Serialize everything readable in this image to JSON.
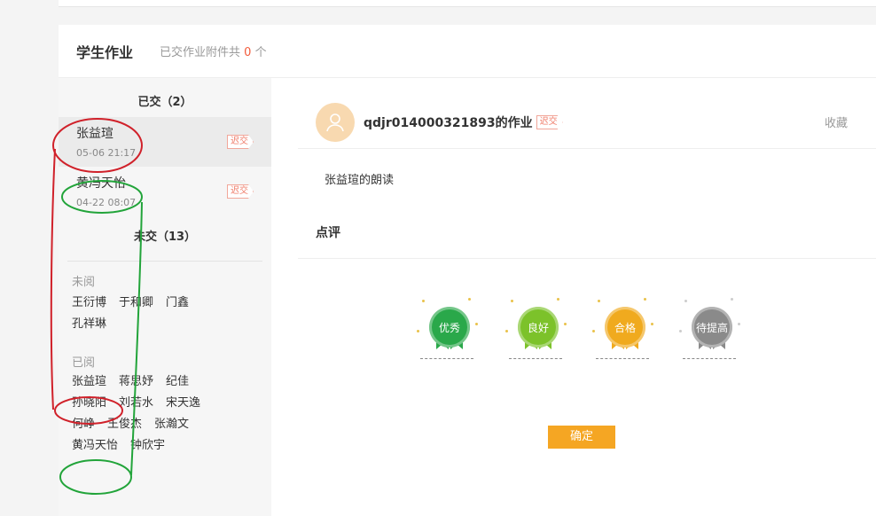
{
  "card": {
    "title": "学生作业",
    "sub_prefix": "已交作业附件共",
    "sub_count": "0",
    "sub_unit": "个"
  },
  "sidebar": {
    "submitted_title": "已交（2）",
    "submissions": [
      {
        "name": "张益瑄",
        "time": "05-06 21:17",
        "tag": "迟交"
      },
      {
        "name": "黄冯天怡",
        "time": "04-22 08:07",
        "tag": "迟交"
      }
    ],
    "unsubmitted_title": "未交（13）",
    "unread_label": "未阅",
    "unread_names": [
      "王衍博",
      "于和卿",
      "门鑫",
      "孔祥琳"
    ],
    "read_label": "已阅",
    "read_names": [
      "张益瑄",
      "蒋思妤",
      "纪佳",
      "孙晓阳",
      "刘若水",
      "宋天逸",
      "何峥",
      "王俊杰",
      "张瀚文",
      "黄冯天怡",
      "钟欣宇"
    ]
  },
  "main": {
    "work_title": "qdjr014000321893的作业",
    "late_tag": "迟交",
    "favorite": "收藏",
    "work_text": "张益瑄的朗读",
    "review_title": "点评",
    "medals": [
      {
        "label": "优秀",
        "color": "#2aa84a"
      },
      {
        "label": "良好",
        "color": "#7cc22a"
      },
      {
        "label": "合格",
        "color": "#f0aa1e"
      },
      {
        "label": "待提高",
        "color": "#8a8a8a"
      }
    ],
    "confirm": "确定"
  }
}
